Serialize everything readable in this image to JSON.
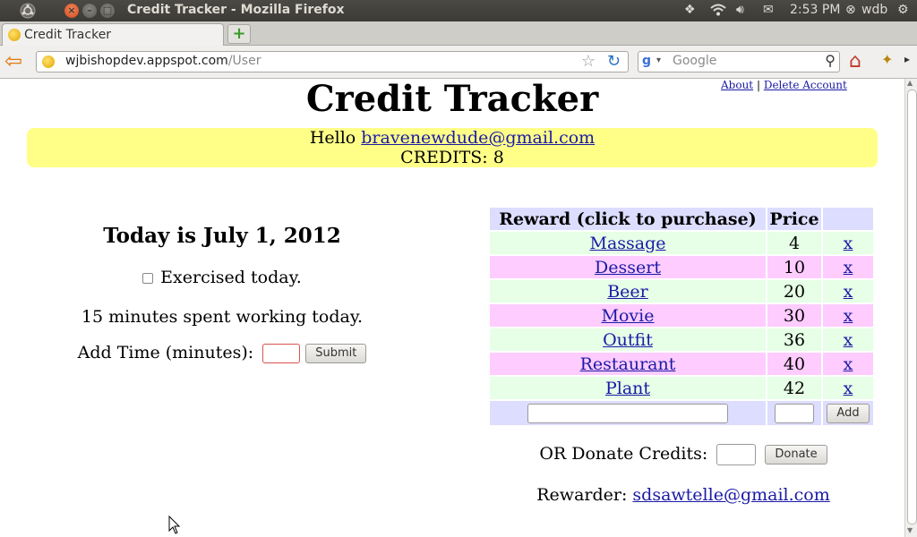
{
  "os": {
    "window_title": "Credit Tracker - Mozilla Firefox",
    "clock": "2:53 PM",
    "user": "wdb"
  },
  "browser": {
    "tab_title": "Credit Tracker",
    "url_host": "wjbishopdev.appspot.com",
    "url_path": "/User",
    "search_placeholder": "Google"
  },
  "page": {
    "about_link": "About",
    "link_separator": "|",
    "delete_account_link": "Delete Account",
    "title": "Credit Tracker",
    "hello_prefix": "Hello",
    "user_email": "bravenewdude@gmail.com",
    "credits_text": "CREDITS: 8",
    "today_text": "Today is July 1, 2012",
    "exercise_label": "Exercised today.",
    "minutes_text": "15 minutes spent working today.",
    "add_time_label": "Add Time (minutes):",
    "submit_label": "Submit",
    "rewards": {
      "col_reward": "Reward (click to purchase)",
      "col_price": "Price",
      "delete_label": "x",
      "add_label": "Add",
      "items": [
        {
          "name": "Massage",
          "price": "4"
        },
        {
          "name": "Dessert",
          "price": "10"
        },
        {
          "name": "Beer",
          "price": "20"
        },
        {
          "name": "Movie",
          "price": "30"
        },
        {
          "name": "Outfit",
          "price": "36"
        },
        {
          "name": "Restaurant",
          "price": "40"
        },
        {
          "name": "Plant",
          "price": "42"
        }
      ]
    },
    "donate_label": "OR Donate Credits:",
    "donate_button": "Donate",
    "rewarder_label": "Rewarder:",
    "rewarder_email": "sdsawtelle@gmail.com"
  },
  "colors": {
    "hello_bg": "#ffff88",
    "header_bg": "#ddddff",
    "row_green": "#e6ffe6",
    "row_pink": "#ffccff",
    "link": "#1a1aa6"
  },
  "icons": [
    "ubuntu-logo-icon",
    "window-close-icon",
    "window-minimize-icon",
    "window-maximize-icon",
    "dropbox-icon",
    "wifi-icon",
    "volume-icon",
    "mail-icon",
    "power-icon",
    "favicon-icon",
    "new-tab-icon",
    "back-arrow-icon",
    "bookmark-star-icon",
    "reload-icon",
    "google-icon",
    "search-icon",
    "home-icon",
    "addon-icon",
    "mouse-cursor-icon"
  ]
}
